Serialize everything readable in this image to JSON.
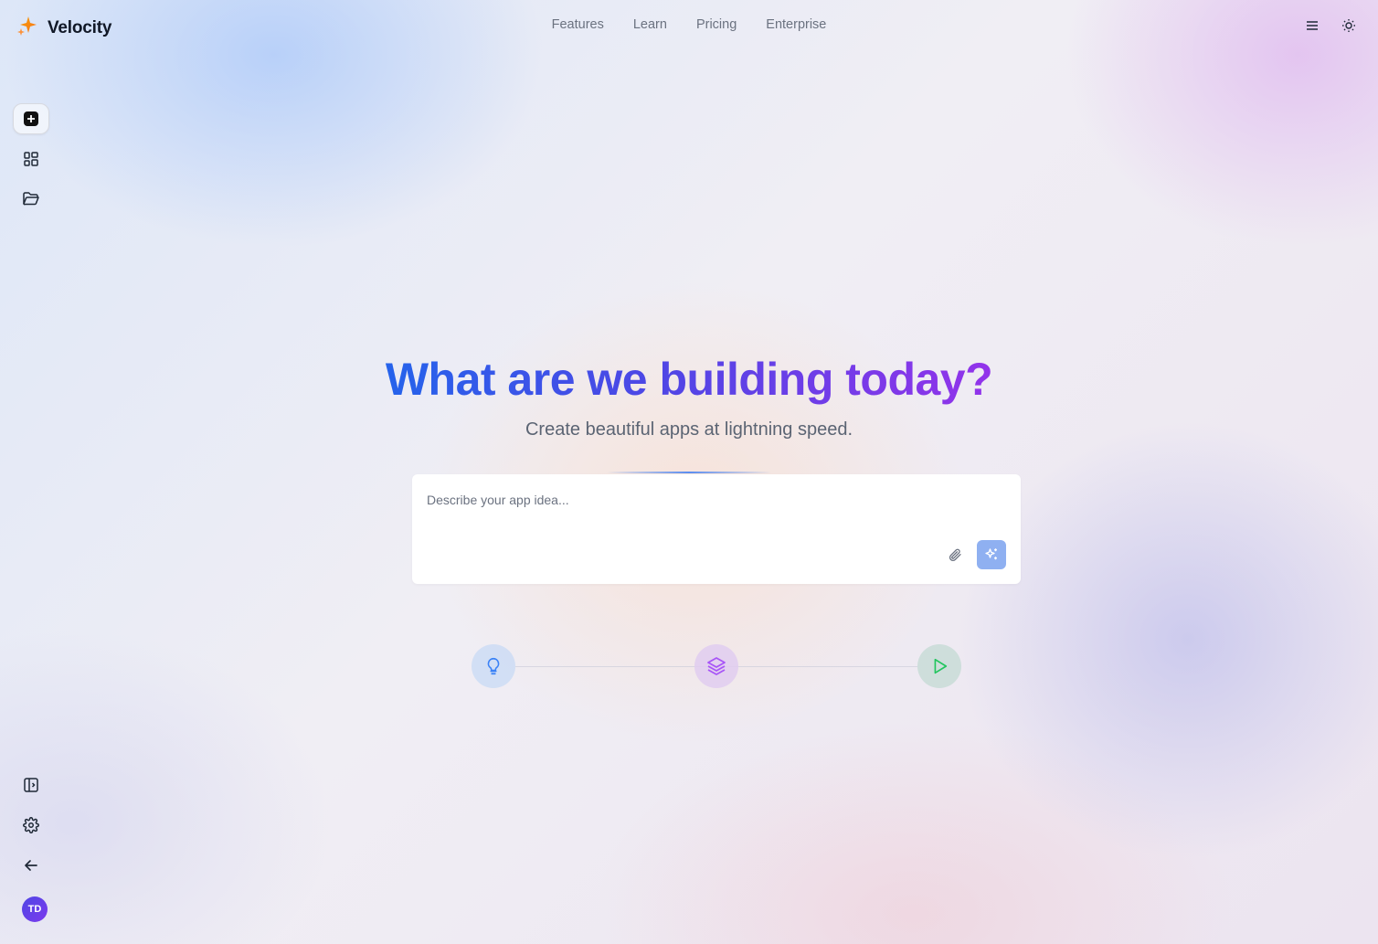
{
  "brand": {
    "name": "Velocity",
    "logo_icon": "sparkle-logo-icon"
  },
  "nav": {
    "items": [
      {
        "label": "Features"
      },
      {
        "label": "Learn"
      },
      {
        "label": "Pricing"
      },
      {
        "label": "Enterprise"
      }
    ]
  },
  "header_actions": {
    "menu_icon": "menu-icon",
    "theme_icon": "sun-icon"
  },
  "sidebar": {
    "top_items": [
      {
        "icon": "plus-icon",
        "active": true
      },
      {
        "icon": "grid-icon",
        "active": false
      },
      {
        "icon": "folder-open-icon",
        "active": false
      }
    ],
    "bottom_items": [
      {
        "icon": "panel-toggle-icon"
      },
      {
        "icon": "gear-icon"
      },
      {
        "icon": "arrow-left-icon"
      }
    ],
    "avatar_initials": "TD"
  },
  "hero": {
    "title": "What are we building today?",
    "subtitle": "Create beautiful apps at lightning speed."
  },
  "prompt": {
    "placeholder": "Describe your app idea...",
    "value": "",
    "attach_icon": "paperclip-icon",
    "generate_icon": "sparkles-icon"
  },
  "steps": [
    {
      "icon": "lightbulb-icon",
      "color": "#3b82f6"
    },
    {
      "icon": "layers-icon",
      "color": "#a855f7"
    },
    {
      "icon": "play-icon",
      "color": "#22c55e"
    }
  ],
  "colors": {
    "title_gradient_start": "#2563eb",
    "title_gradient_end": "#9333ea",
    "generate_button": "#8fb0f1",
    "avatar": "#5b46e5"
  }
}
